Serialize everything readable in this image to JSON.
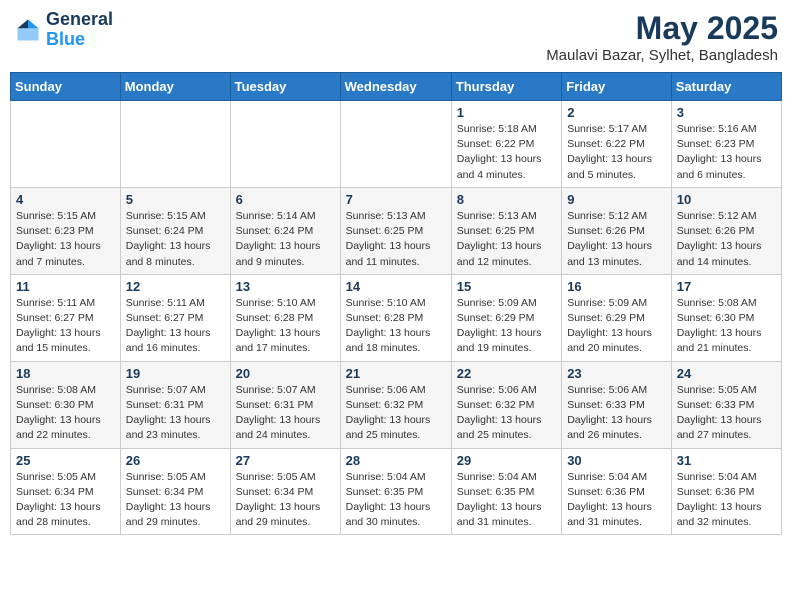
{
  "header": {
    "logo_line1": "General",
    "logo_line2": "Blue",
    "title": "May 2025",
    "subtitle": "Maulavi Bazar, Sylhet, Bangladesh"
  },
  "weekdays": [
    "Sunday",
    "Monday",
    "Tuesday",
    "Wednesday",
    "Thursday",
    "Friday",
    "Saturday"
  ],
  "weeks": [
    [
      {
        "day": "",
        "detail": ""
      },
      {
        "day": "",
        "detail": ""
      },
      {
        "day": "",
        "detail": ""
      },
      {
        "day": "",
        "detail": ""
      },
      {
        "day": "1",
        "detail": "Sunrise: 5:18 AM\nSunset: 6:22 PM\nDaylight: 13 hours\nand 4 minutes."
      },
      {
        "day": "2",
        "detail": "Sunrise: 5:17 AM\nSunset: 6:22 PM\nDaylight: 13 hours\nand 5 minutes."
      },
      {
        "day": "3",
        "detail": "Sunrise: 5:16 AM\nSunset: 6:23 PM\nDaylight: 13 hours\nand 6 minutes."
      }
    ],
    [
      {
        "day": "4",
        "detail": "Sunrise: 5:15 AM\nSunset: 6:23 PM\nDaylight: 13 hours\nand 7 minutes."
      },
      {
        "day": "5",
        "detail": "Sunrise: 5:15 AM\nSunset: 6:24 PM\nDaylight: 13 hours\nand 8 minutes."
      },
      {
        "day": "6",
        "detail": "Sunrise: 5:14 AM\nSunset: 6:24 PM\nDaylight: 13 hours\nand 9 minutes."
      },
      {
        "day": "7",
        "detail": "Sunrise: 5:13 AM\nSunset: 6:25 PM\nDaylight: 13 hours\nand 11 minutes."
      },
      {
        "day": "8",
        "detail": "Sunrise: 5:13 AM\nSunset: 6:25 PM\nDaylight: 13 hours\nand 12 minutes."
      },
      {
        "day": "9",
        "detail": "Sunrise: 5:12 AM\nSunset: 6:26 PM\nDaylight: 13 hours\nand 13 minutes."
      },
      {
        "day": "10",
        "detail": "Sunrise: 5:12 AM\nSunset: 6:26 PM\nDaylight: 13 hours\nand 14 minutes."
      }
    ],
    [
      {
        "day": "11",
        "detail": "Sunrise: 5:11 AM\nSunset: 6:27 PM\nDaylight: 13 hours\nand 15 minutes."
      },
      {
        "day": "12",
        "detail": "Sunrise: 5:11 AM\nSunset: 6:27 PM\nDaylight: 13 hours\nand 16 minutes."
      },
      {
        "day": "13",
        "detail": "Sunrise: 5:10 AM\nSunset: 6:28 PM\nDaylight: 13 hours\nand 17 minutes."
      },
      {
        "day": "14",
        "detail": "Sunrise: 5:10 AM\nSunset: 6:28 PM\nDaylight: 13 hours\nand 18 minutes."
      },
      {
        "day": "15",
        "detail": "Sunrise: 5:09 AM\nSunset: 6:29 PM\nDaylight: 13 hours\nand 19 minutes."
      },
      {
        "day": "16",
        "detail": "Sunrise: 5:09 AM\nSunset: 6:29 PM\nDaylight: 13 hours\nand 20 minutes."
      },
      {
        "day": "17",
        "detail": "Sunrise: 5:08 AM\nSunset: 6:30 PM\nDaylight: 13 hours\nand 21 minutes."
      }
    ],
    [
      {
        "day": "18",
        "detail": "Sunrise: 5:08 AM\nSunset: 6:30 PM\nDaylight: 13 hours\nand 22 minutes."
      },
      {
        "day": "19",
        "detail": "Sunrise: 5:07 AM\nSunset: 6:31 PM\nDaylight: 13 hours\nand 23 minutes."
      },
      {
        "day": "20",
        "detail": "Sunrise: 5:07 AM\nSunset: 6:31 PM\nDaylight: 13 hours\nand 24 minutes."
      },
      {
        "day": "21",
        "detail": "Sunrise: 5:06 AM\nSunset: 6:32 PM\nDaylight: 13 hours\nand 25 minutes."
      },
      {
        "day": "22",
        "detail": "Sunrise: 5:06 AM\nSunset: 6:32 PM\nDaylight: 13 hours\nand 25 minutes."
      },
      {
        "day": "23",
        "detail": "Sunrise: 5:06 AM\nSunset: 6:33 PM\nDaylight: 13 hours\nand 26 minutes."
      },
      {
        "day": "24",
        "detail": "Sunrise: 5:05 AM\nSunset: 6:33 PM\nDaylight: 13 hours\nand 27 minutes."
      }
    ],
    [
      {
        "day": "25",
        "detail": "Sunrise: 5:05 AM\nSunset: 6:34 PM\nDaylight: 13 hours\nand 28 minutes."
      },
      {
        "day": "26",
        "detail": "Sunrise: 5:05 AM\nSunset: 6:34 PM\nDaylight: 13 hours\nand 29 minutes."
      },
      {
        "day": "27",
        "detail": "Sunrise: 5:05 AM\nSunset: 6:34 PM\nDaylight: 13 hours\nand 29 minutes."
      },
      {
        "day": "28",
        "detail": "Sunrise: 5:04 AM\nSunset: 6:35 PM\nDaylight: 13 hours\nand 30 minutes."
      },
      {
        "day": "29",
        "detail": "Sunrise: 5:04 AM\nSunset: 6:35 PM\nDaylight: 13 hours\nand 31 minutes."
      },
      {
        "day": "30",
        "detail": "Sunrise: 5:04 AM\nSunset: 6:36 PM\nDaylight: 13 hours\nand 31 minutes."
      },
      {
        "day": "31",
        "detail": "Sunrise: 5:04 AM\nSunset: 6:36 PM\nDaylight: 13 hours\nand 32 minutes."
      }
    ]
  ]
}
